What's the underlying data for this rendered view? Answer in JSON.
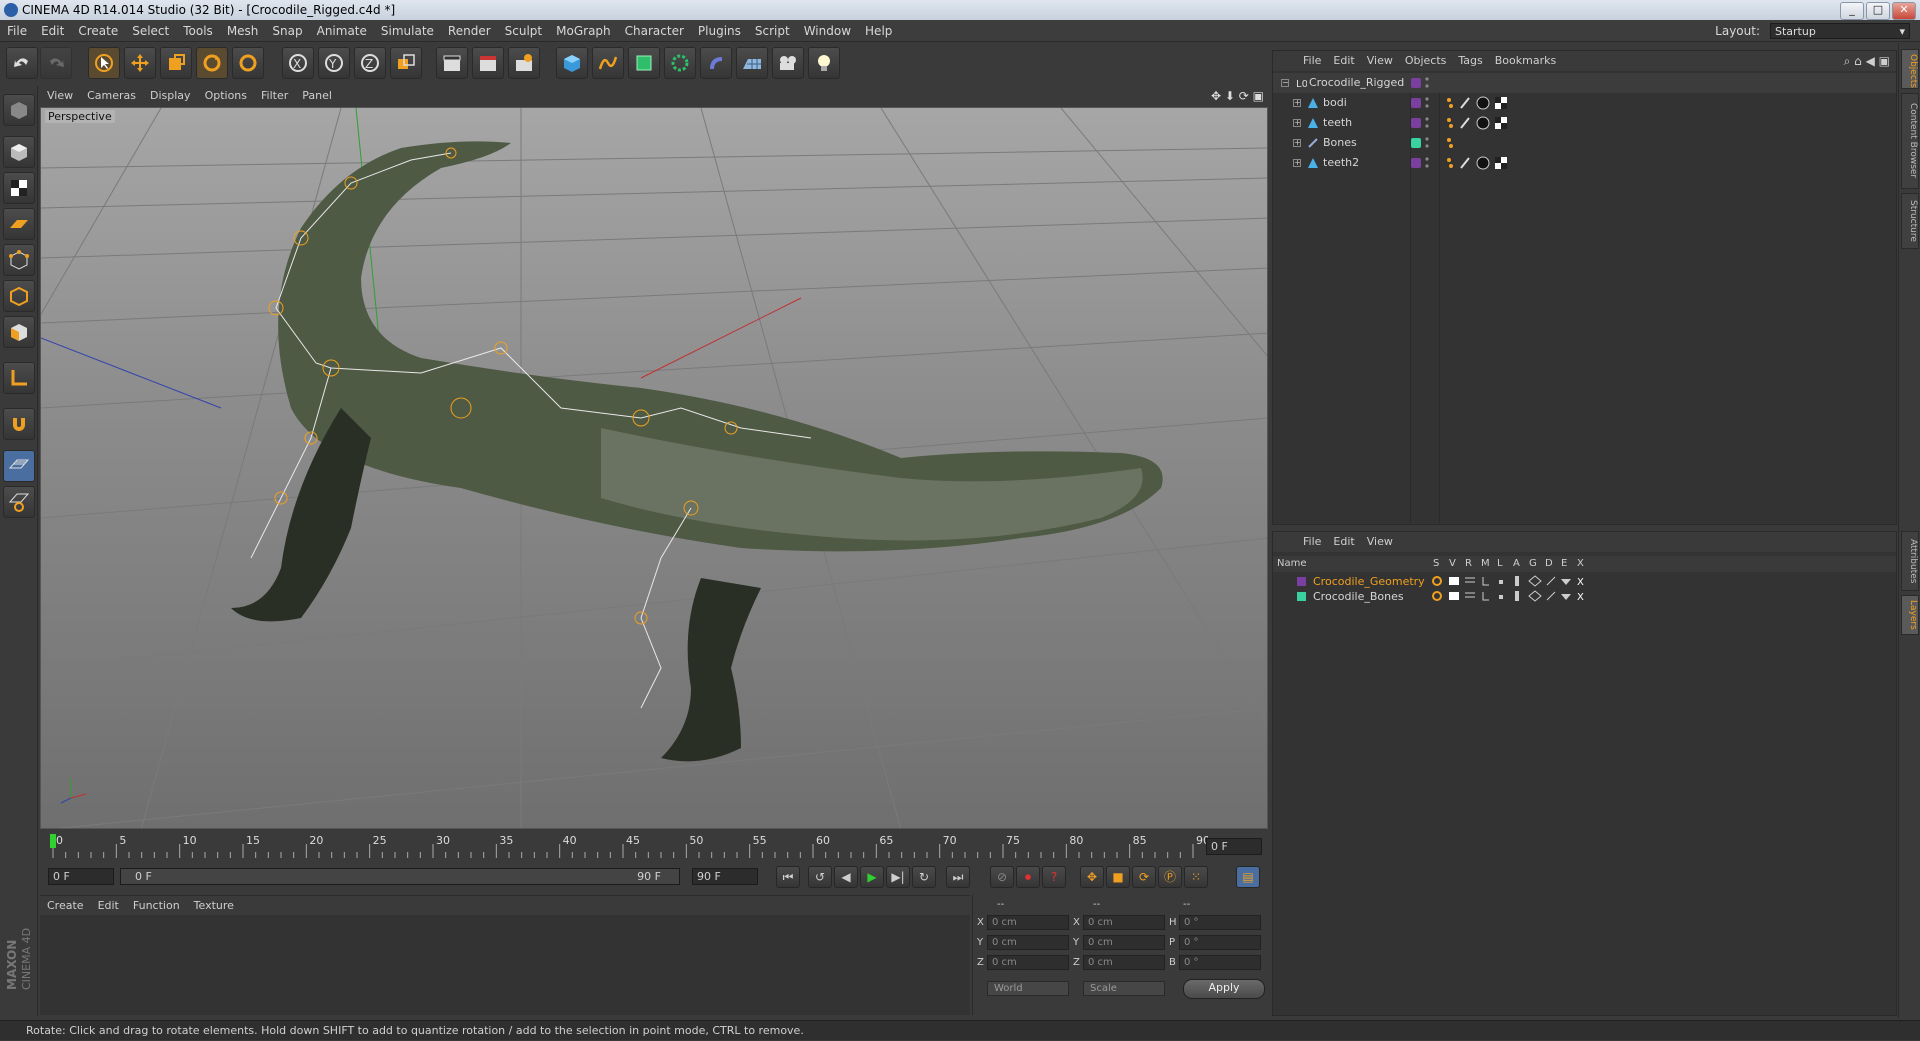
{
  "window": {
    "title": "CINEMA 4D R14.014 Studio (32 Bit) - [Crocodile_Rigged.c4d *]",
    "buttons": [
      "minimize",
      "maximize",
      "close"
    ]
  },
  "menubar": {
    "items": [
      "File",
      "Edit",
      "Create",
      "Select",
      "Tools",
      "Mesh",
      "Snap",
      "Animate",
      "Simulate",
      "Render",
      "Sculpt",
      "MoGraph",
      "Character",
      "Plugins",
      "Script",
      "Window",
      "Help"
    ],
    "layout_label": "Layout:",
    "layout_value": "Startup"
  },
  "viewport": {
    "menu": [
      "View",
      "Cameras",
      "Display",
      "Options",
      "Filter",
      "Panel"
    ],
    "camera_label": "Perspective"
  },
  "timeline": {
    "ticks": [
      "0",
      "5",
      "10",
      "15",
      "20",
      "25",
      "30",
      "35",
      "40",
      "45",
      "50",
      "55",
      "60",
      "65",
      "70",
      "75",
      "80",
      "85",
      "90"
    ],
    "current_frame": "0 F",
    "start_field": "0 F",
    "range_start": "0 F",
    "range_end": "90 F",
    "end_field": "90 F",
    "playhead": 0,
    "frame_max": 90
  },
  "material_panel": {
    "menu": [
      "Create",
      "Edit",
      "Function",
      "Texture"
    ]
  },
  "coords_panel": {
    "header": [
      "--",
      "--",
      "--"
    ],
    "rows": [
      {
        "a": "X",
        "av": "0 cm",
        "b": "X",
        "bv": "0 cm",
        "c": "H",
        "cv": "0 °"
      },
      {
        "a": "Y",
        "av": "0 cm",
        "b": "Y",
        "bv": "0 cm",
        "c": "P",
        "cv": "0 °"
      },
      {
        "a": "Z",
        "av": "0 cm",
        "b": "Z",
        "bv": "0 cm",
        "c": "B",
        "cv": "0 °"
      }
    ],
    "world_drop": "World",
    "scale_drop": "Scale",
    "apply": "Apply"
  },
  "object_manager": {
    "menu": [
      "File",
      "Edit",
      "View",
      "Objects",
      "Tags",
      "Bookmarks"
    ],
    "objects": [
      {
        "name": "Crocodile_Rigged",
        "color": "#7a3fa0",
        "level": 0,
        "type": "null"
      },
      {
        "name": "bodi",
        "color": "#7a3fa0",
        "level": 1,
        "type": "mesh"
      },
      {
        "name": "teeth",
        "color": "#7a3fa0",
        "level": 1,
        "type": "mesh"
      },
      {
        "name": "Bones",
        "color": "#3ad1a0",
        "level": 1,
        "type": "joint"
      },
      {
        "name": "teeth2",
        "color": "#7a3fa0",
        "level": 1,
        "type": "mesh"
      }
    ]
  },
  "layer_manager": {
    "menu": [
      "File",
      "Edit",
      "View"
    ],
    "columns": [
      "Name",
      "S",
      "V",
      "R",
      "M",
      "L",
      "A",
      "G",
      "D",
      "E",
      "X"
    ],
    "layers": [
      {
        "name": "Crocodile_Geometry",
        "color": "#7a3fa0",
        "text_color": "#f0a020"
      },
      {
        "name": "Crocodile_Bones",
        "color": "#3ad1a0",
        "text_color": "#d6d6d6"
      }
    ]
  },
  "sidetabs": [
    "Objects",
    "Content Browser",
    "Structure",
    "Attributes",
    "Layers"
  ],
  "statusbar": {
    "text": "Rotate: Click and drag to rotate elements. Hold down SHIFT to add to quantize rotation / add to the selection in point mode, CTRL to remove."
  },
  "branding": {
    "logo_text": "MAXON CINEMA 4D"
  },
  "colors": {
    "accent_orange": "#f0a020",
    "panel_bg": "#333333",
    "toolbar_bg": "#3a3a3a"
  }
}
